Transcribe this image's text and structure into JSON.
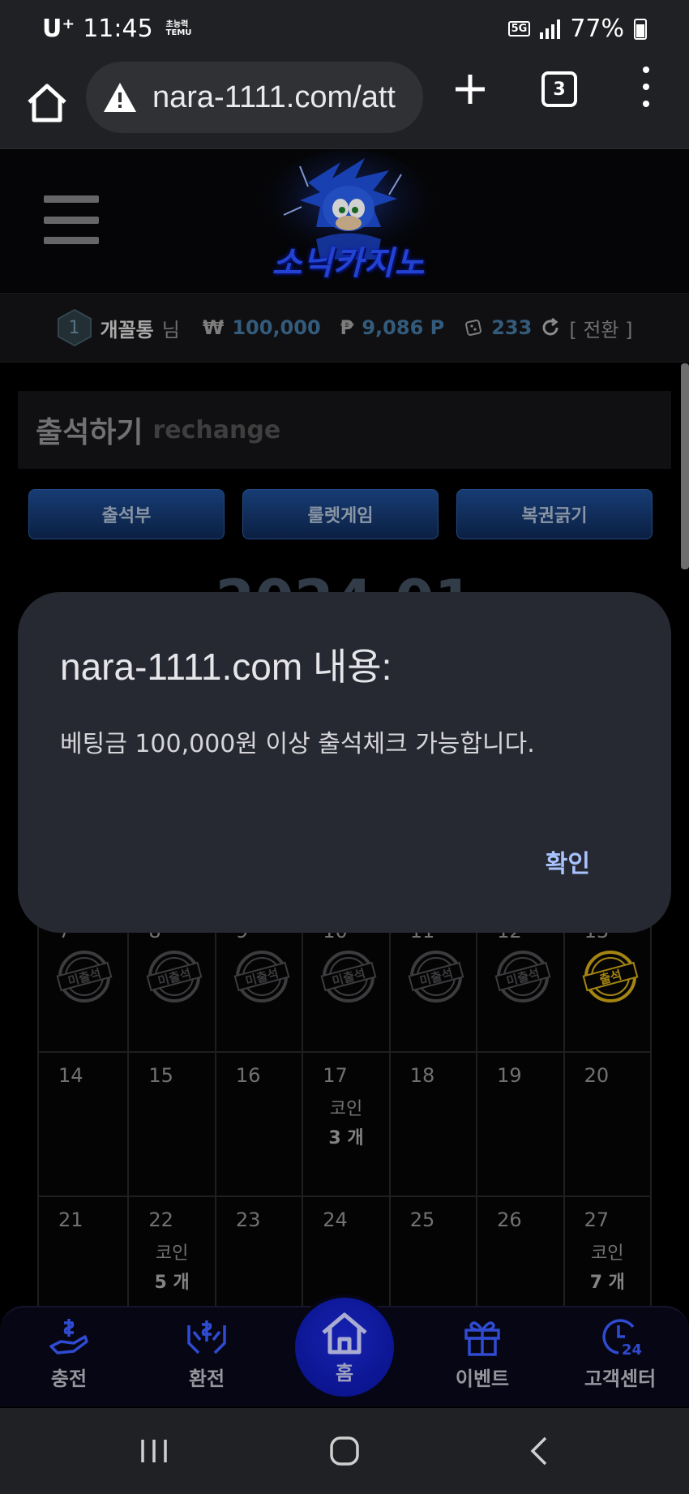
{
  "status_bar": {
    "carrier": "U⁺",
    "time": "11:45",
    "notif_top": "초능력",
    "notif_bottom": "TEMU",
    "network": "5G",
    "battery": "77%"
  },
  "browser": {
    "url": "nara-1111.com/att",
    "tab_count": "3"
  },
  "site": {
    "logo_text": "소닉카지노",
    "user": {
      "level": "1",
      "name": "개꼴통",
      "honorific": "님",
      "won_symbol": "₩",
      "balance": "100,000",
      "point_symbol": "₱",
      "points": "9,086 P",
      "chips": "233",
      "convert_label": "[ 전환 ]"
    },
    "section": {
      "title_ko": "출석하기",
      "title_en": "rechange"
    },
    "tabs": [
      "출석부",
      "룰렛게임",
      "복권긁기"
    ],
    "month_label": "2024.01",
    "calendar": {
      "week2": [
        {
          "day": "7",
          "stamp": "미출석"
        },
        {
          "day": "8",
          "stamp": "미출석"
        },
        {
          "day": "9",
          "stamp": "미출석"
        },
        {
          "day": "10",
          "stamp": "미출석"
        },
        {
          "day": "11",
          "stamp": "미출석"
        },
        {
          "day": "12",
          "stamp": "미출석"
        },
        {
          "day": "13",
          "stamp": "출석"
        }
      ],
      "week3": [
        {
          "day": "14"
        },
        {
          "day": "15"
        },
        {
          "day": "16"
        },
        {
          "day": "17",
          "coin_label": "코인",
          "coin_count": "3 개"
        },
        {
          "day": "18"
        },
        {
          "day": "19"
        },
        {
          "day": "20"
        }
      ],
      "week4": [
        {
          "day": "21"
        },
        {
          "day": "22",
          "coin_label": "코인",
          "coin_count": "5 개"
        },
        {
          "day": "23"
        },
        {
          "day": "24"
        },
        {
          "day": "25"
        },
        {
          "day": "26"
        },
        {
          "day": "27",
          "coin_label": "코인",
          "coin_count": "7 개"
        }
      ]
    },
    "bottom_nav": [
      "충전",
      "환전",
      "홈",
      "이벤트",
      "고객센터"
    ]
  },
  "dialog": {
    "title": "nara-1111.com 내용:",
    "message": "베팅금 100,000원 이상 출석체크 가능합니다.",
    "ok_label": "확인"
  },
  "colors": {
    "dialog_bg": "#272932",
    "accent_link": "#a9c3ff",
    "brand_blue": "#1a2ad8",
    "stamp_gold": "#c9a316"
  }
}
